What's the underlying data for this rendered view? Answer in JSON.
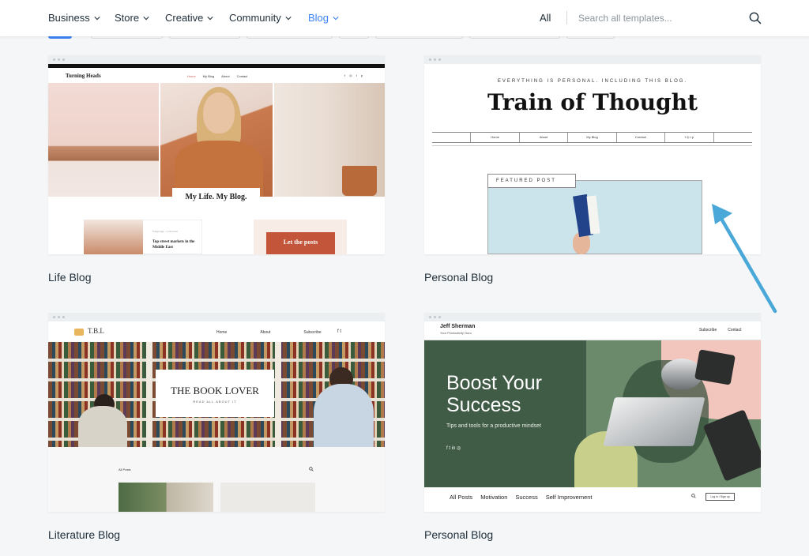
{
  "nav": {
    "categories": [
      {
        "label": "Business",
        "active": false
      },
      {
        "label": "Store",
        "active": false
      },
      {
        "label": "Creative",
        "active": false
      },
      {
        "label": "Community",
        "active": false
      },
      {
        "label": "Blog",
        "active": true
      }
    ],
    "all_label": "All",
    "search_placeholder": "Search all templates...",
    "search_icon": "search-icon",
    "accent_color": "#3b82f6"
  },
  "templates": [
    {
      "title": "Life Blog",
      "preview": {
        "site_name": "Turning Heads",
        "menu": [
          "Home",
          "My Blog",
          "About",
          "Contact"
        ],
        "social": [
          "f",
          "◎",
          "t",
          "p"
        ],
        "hero_caption": "My Life. My Blog.",
        "post_meta": "5 days ago · 1 min read",
        "post_title": "Top street markets in the Middle East",
        "cta_label": "Let the posts"
      }
    },
    {
      "title": "Personal Blog",
      "preview": {
        "tagline": "EVERYTHING IS PERSONAL. INCLUDING THIS BLOG.",
        "site_name": "Train of Thought",
        "menu": [
          "Home",
          "About",
          "My Blog",
          "Contact"
        ],
        "social": "f ◎ t p",
        "featured_label": "FEATURED POST"
      }
    },
    {
      "title": "Literature Blog",
      "preview": {
        "site_name": "T.B.L",
        "menu": [
          "Home",
          "About",
          "Subscribe"
        ],
        "social": "f t",
        "hero_title": "THE BOOK LOVER",
        "hero_subtitle": "READ ALL ABOUT IT",
        "section_label": "All Posts"
      }
    },
    {
      "title": "Personal Blog",
      "preview": {
        "author_name": "Jeff Sherman",
        "author_subtitle": "Your Productivity Guru",
        "menu": [
          "Subscribe",
          "Contact"
        ],
        "hero_title": "Boost Your Success",
        "hero_tagline": "Tips and tools for a productive mindset",
        "social": "f t in ◎",
        "categories": [
          "All Posts",
          "Motivation",
          "Success",
          "Self Improvement"
        ],
        "login_label": "Log in / Sign up"
      }
    }
  ],
  "annotation": {
    "type": "arrow",
    "color": "#4aa8d8",
    "points_to": "Personal Blog (Train of Thought) preview"
  }
}
